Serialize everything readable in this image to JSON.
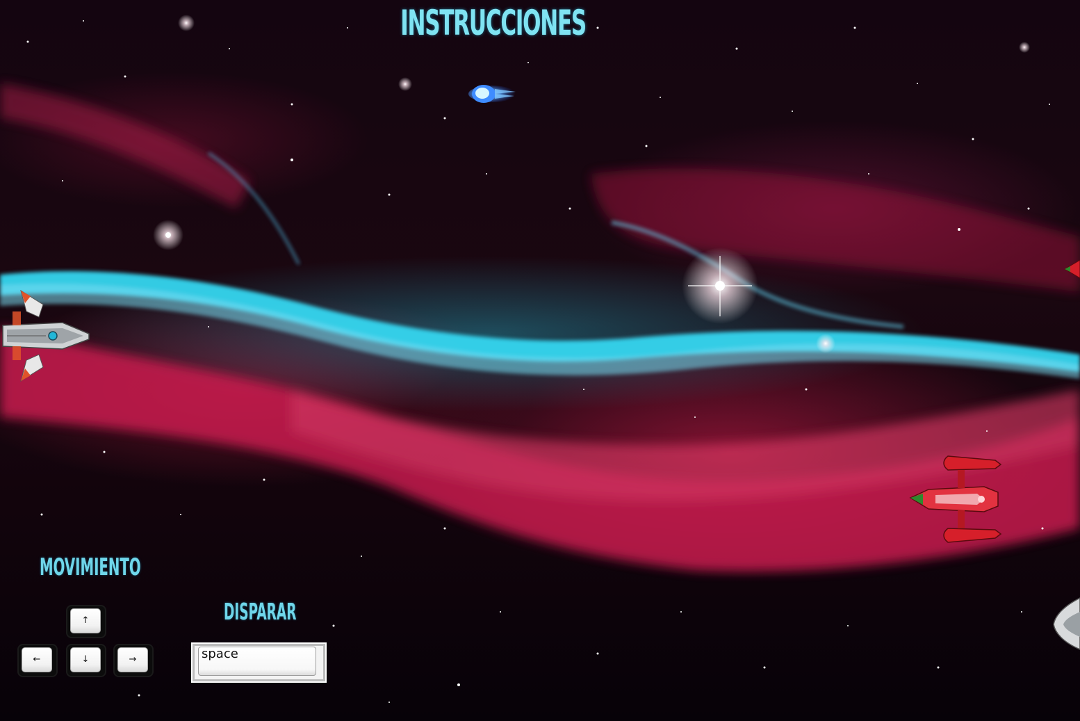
{
  "screen": {
    "title": "INSTRUCCIONES"
  },
  "controls": {
    "movement_label": "MOVIMIENTO",
    "fire_label": "DISPARAR",
    "keys": {
      "up": "↑",
      "left": "←",
      "down": "↓",
      "right": "→",
      "fire": "space"
    }
  },
  "colors": {
    "heading": "#7fe3f2",
    "nebula_cyan": "#2fd3ee",
    "nebula_red": "#e0285a"
  }
}
